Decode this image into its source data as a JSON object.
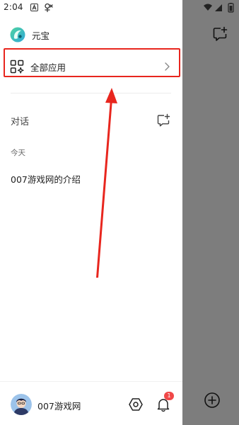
{
  "status_bar": {
    "time": "2:04"
  },
  "brand": {
    "name": "元宝",
    "logo_icon": "yuanbao-logo-icon"
  },
  "menu": {
    "all_apps_label": "全部应用",
    "all_apps_icon": "apps-grid-icon"
  },
  "conversations": {
    "section_title": "对话",
    "new_chat_icon": "new-chat-icon",
    "groups": [
      {
        "date_label": "今天",
        "items": [
          {
            "title": "007游戏网的介绍"
          }
        ]
      }
    ]
  },
  "user": {
    "name": "007游戏网",
    "notification_count": "1"
  },
  "colors": {
    "highlight": "#e8261e",
    "badge": "#f04848",
    "overlay": "#7d7d7d"
  }
}
